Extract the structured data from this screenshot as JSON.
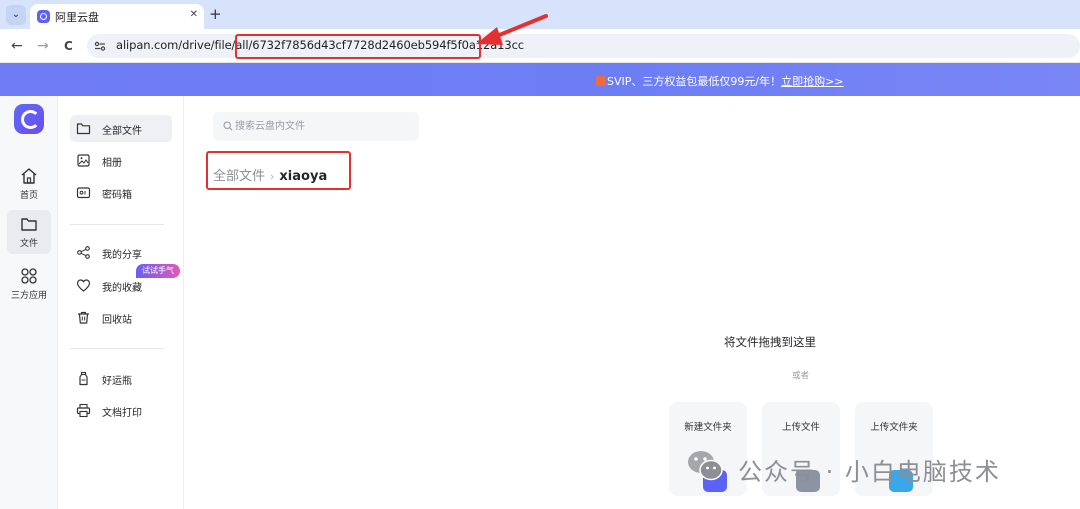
{
  "browser": {
    "tab_menu_icon": "chevron-down-icon",
    "tab_title": "阿里云盘",
    "tab_close": "✕",
    "new_tab": "+",
    "back": "←",
    "forward": "→",
    "reload": "C",
    "address": "alipan.com/drive/file/all/6732f7856d43cf7728d2460eb594f5f0a12a13cc"
  },
  "banner": {
    "text": "SVIP、三方权益包最低仅99元/年！",
    "link": "立即抢购>>"
  },
  "rail": {
    "items": [
      {
        "label": "首页",
        "icon": "home-icon"
      },
      {
        "label": "文件",
        "icon": "folder-icon"
      },
      {
        "label": "三方应用",
        "icon": "apps-icon"
      }
    ]
  },
  "sidebar": {
    "items": [
      {
        "label": "全部文件",
        "icon": "folder-icon"
      },
      {
        "label": "相册",
        "icon": "photo-icon"
      },
      {
        "label": "密码箱",
        "icon": "safe-icon"
      },
      {
        "label": "我的分享",
        "icon": "share-icon"
      },
      {
        "label": "我的收藏",
        "icon": "heart-icon"
      },
      {
        "label": "回收站",
        "icon": "trash-icon"
      },
      {
        "label": "好运瓶",
        "icon": "bottle-icon"
      },
      {
        "label": "文档打印",
        "icon": "printer-icon"
      }
    ],
    "trial_badge": "试试手气"
  },
  "main": {
    "search_placeholder": "搜索云盘内文件",
    "breadcrumb": {
      "root": "全部文件",
      "separator": "›",
      "current": "xiaoya"
    },
    "drop_title": "将文件拖拽到这里",
    "drop_or": "或者",
    "actions": [
      {
        "label": "新建文件夹",
        "color": "#5b62f5"
      },
      {
        "label": "上传文件",
        "color": "#8c93a3"
      },
      {
        "label": "上传文件夹",
        "color": "#3aa7e8"
      }
    ]
  },
  "watermark": {
    "text": "公众号 · 小白电脑技术"
  },
  "colors": {
    "accent": "#5b62f5",
    "annotation": "#e3312f",
    "banner": "#6f7cf6"
  }
}
